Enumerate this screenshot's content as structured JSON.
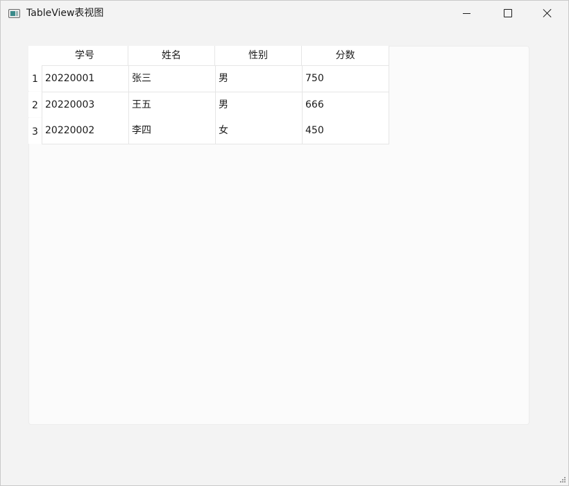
{
  "window": {
    "title": "TableView表视图"
  },
  "table": {
    "headers": [
      "学号",
      "姓名",
      "性别",
      "分数"
    ],
    "row_numbers": [
      "1",
      "2",
      "3"
    ],
    "rows": [
      [
        "20220001",
        "张三",
        "男",
        "750"
      ],
      [
        "20220003",
        "王五",
        "男",
        "666"
      ],
      [
        "20220002",
        "李四",
        "女",
        "450"
      ]
    ]
  },
  "icons": {
    "app": "window-app-icon",
    "minimize": "minimize-icon",
    "maximize": "maximize-icon",
    "close": "close-icon",
    "resize": "resize-grip-icon"
  },
  "colors": {
    "window_bg": "#f3f3f3",
    "table_bg": "#ffffff",
    "grid_line": "#e5e5e5",
    "panel_bg": "#fbfbfb"
  }
}
